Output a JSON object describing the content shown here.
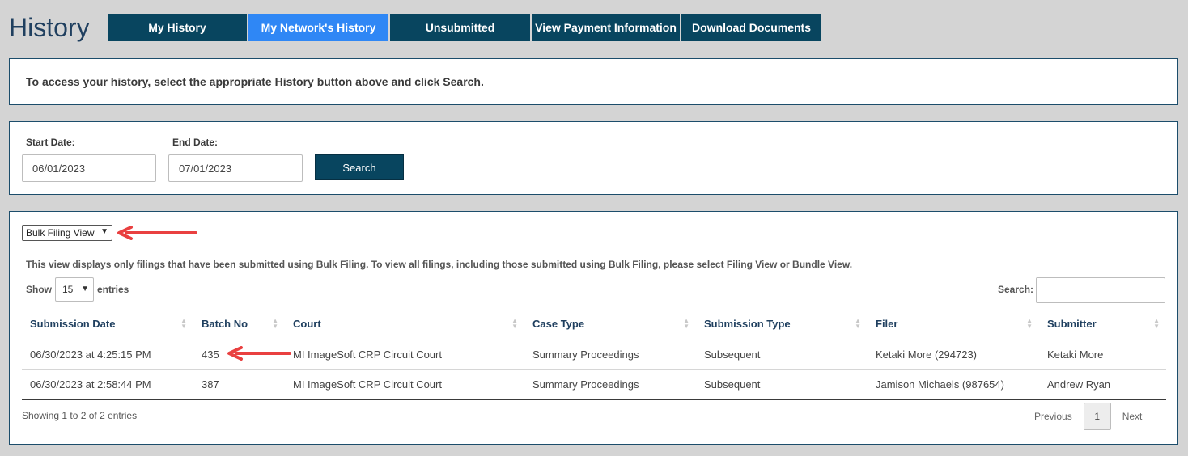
{
  "page": {
    "title": "History"
  },
  "tabs": [
    {
      "label": "My History",
      "active": false
    },
    {
      "label": "My Network's History",
      "active": true
    },
    {
      "label": "Unsubmitted",
      "active": false
    },
    {
      "label": "View Payment Information",
      "active": false
    },
    {
      "label": "Download Documents",
      "active": false
    }
  ],
  "info": {
    "text": "To access your history, select the appropriate History button above and click Search."
  },
  "search_form": {
    "start_label": "Start Date:",
    "start_value": "06/01/2023",
    "end_label": "End Date:",
    "end_value": "07/01/2023",
    "search_button": "Search"
  },
  "results": {
    "view_select": "Bulk Filing View",
    "description": "This view displays only filings that have been submitted using Bulk Filing. To view all filings, including those submitted using Bulk Filing, please select Filing View or Bundle View.",
    "show_label": "Show",
    "page_length": "15",
    "entries_label": "entries",
    "search_label": "Search:",
    "search_value": "",
    "columns": [
      "Submission Date",
      "Batch No",
      "Court",
      "Case Type",
      "Submission Type",
      "Filer",
      "Submitter"
    ],
    "rows": [
      [
        "06/30/2023 at 4:25:15 PM",
        "435",
        "MI ImageSoft CRP Circuit Court",
        "Summary Proceedings",
        "Subsequent",
        "Ketaki More (294723)",
        "Ketaki More"
      ],
      [
        "06/30/2023 at 2:58:44 PM",
        "387",
        "MI ImageSoft CRP Circuit Court",
        "Summary Proceedings",
        "Subsequent",
        "Jamison Michaels (987654)",
        "Andrew Ryan"
      ]
    ],
    "showing_text": "Showing 1 to 2 of 2 entries",
    "pager": {
      "previous": "Previous",
      "current": "1",
      "next": "Next"
    }
  },
  "colors": {
    "tab": "#08455f",
    "tab_active": "#2f87f5",
    "annotation_arrow": "#e94040"
  },
  "icons": {
    "sort": "sort-icon",
    "arrow": "annotation-arrow-icon",
    "caret": "chevron-down-icon"
  }
}
